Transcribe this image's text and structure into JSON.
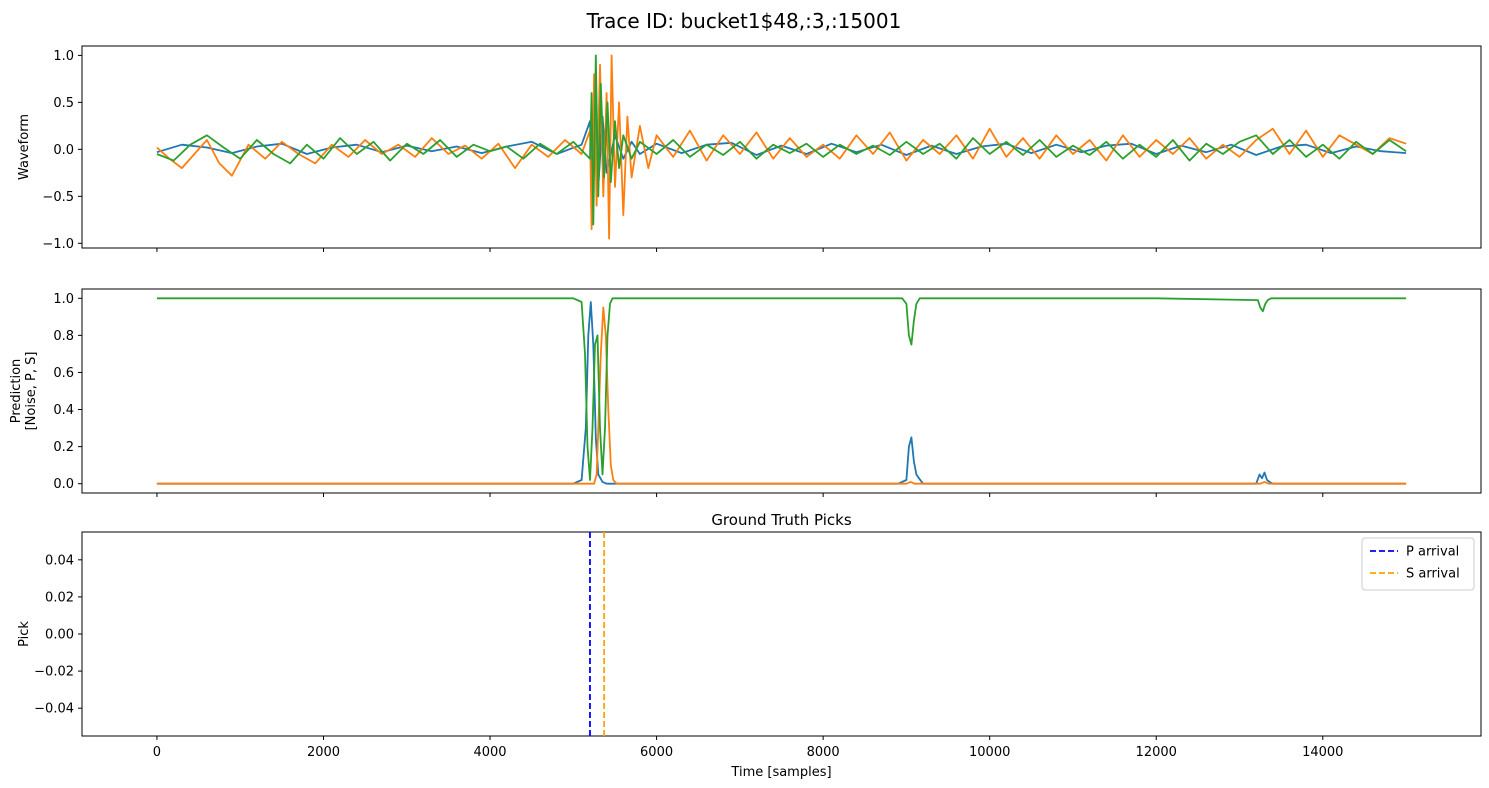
{
  "figure": {
    "title": "Trace ID: bucket1$48,:3,:15001"
  },
  "colors": {
    "blue": "#1f77b4",
    "orange": "#ff7f0e",
    "green": "#2ca02c",
    "p_line": "#0000ff",
    "s_line": "#ffa500"
  },
  "chart_data": [
    {
      "type": "line",
      "title": "",
      "xlabel": "",
      "ylabel": "Waveform",
      "xlim": [
        -900,
        15900
      ],
      "ylim": [
        -1.05,
        1.1
      ],
      "yticks": [
        1.0,
        0.5,
        0.0,
        -0.5,
        -1.0
      ],
      "ytick_labels": [
        "1.0",
        "0.5",
        "0.0",
        "−0.5",
        "−1.0"
      ],
      "xticks_shown": false,
      "grid": false,
      "series": [
        {
          "color": "blue",
          "x": [
            0,
            300,
            600,
            900,
            1200,
            1500,
            1800,
            2100,
            2400,
            2700,
            3000,
            3300,
            3600,
            3900,
            4200,
            4500,
            4800,
            5100,
            5200,
            5230,
            5260,
            5300,
            5350,
            5400,
            5500,
            5600,
            5700,
            5800,
            6000,
            6300,
            6600,
            6900,
            7200,
            7500,
            7800,
            8100,
            8400,
            8700,
            9000,
            9300,
            9600,
            9900,
            10200,
            10500,
            10800,
            11100,
            11400,
            11700,
            12000,
            12300,
            12600,
            12900,
            13200,
            13500,
            13800,
            14100,
            14400,
            14700,
            15000
          ],
          "y": [
            -0.03,
            0.05,
            0.02,
            -0.04,
            0.03,
            0.06,
            -0.05,
            0.02,
            0.05,
            -0.03,
            0.04,
            -0.02,
            0.03,
            -0.04,
            0.03,
            0.08,
            -0.05,
            0.05,
            0.3,
            -0.6,
            0.7,
            -0.4,
            0.35,
            -0.25,
            0.15,
            -0.1,
            0.08,
            -0.05,
            0.06,
            -0.04,
            0.05,
            0.07,
            -0.06,
            0.04,
            -0.05,
            0.06,
            -0.03,
            0.05,
            -0.06,
            0.04,
            -0.05,
            0.03,
            0.06,
            -0.04,
            0.05,
            -0.03,
            0.04,
            0.06,
            -0.05,
            0.04,
            -0.03,
            0.05,
            -0.06,
            0.03,
            0.05,
            -0.04,
            0.03,
            -0.02,
            -0.04
          ]
        },
        {
          "color": "orange",
          "x": [
            0,
            150,
            300,
            450,
            600,
            750,
            900,
            1100,
            1300,
            1500,
            1700,
            1900,
            2100,
            2300,
            2500,
            2700,
            2900,
            3100,
            3300,
            3500,
            3700,
            3900,
            4100,
            4300,
            4500,
            4700,
            4900,
            5100,
            5200,
            5220,
            5250,
            5280,
            5320,
            5360,
            5400,
            5430,
            5460,
            5500,
            5550,
            5600,
            5650,
            5700,
            5800,
            5900,
            6000,
            6200,
            6400,
            6600,
            6800,
            7000,
            7200,
            7400,
            7600,
            7800,
            8000,
            8200,
            8400,
            8600,
            8800,
            9000,
            9200,
            9400,
            9600,
            9800,
            10000,
            10200,
            10400,
            10600,
            10800,
            11000,
            11200,
            11400,
            11600,
            11800,
            12000,
            12200,
            12400,
            12600,
            12800,
            13000,
            13200,
            13400,
            13600,
            13800,
            14000,
            14200,
            14400,
            14600,
            14800,
            15000
          ],
          "y": [
            0.02,
            -0.1,
            -0.2,
            -0.05,
            0.1,
            -0.15,
            -0.28,
            0.05,
            -0.1,
            0.08,
            -0.05,
            -0.15,
            0.05,
            -0.08,
            0.1,
            -0.05,
            0.05,
            -0.08,
            0.12,
            -0.05,
            0.04,
            -0.1,
            0.06,
            -0.2,
            0.05,
            -0.08,
            0.1,
            -0.05,
            0.2,
            -0.85,
            0.8,
            -0.6,
            0.9,
            -0.5,
            0.6,
            -0.95,
            1.0,
            -0.4,
            0.5,
            -0.7,
            0.35,
            -0.3,
            0.25,
            -0.2,
            0.15,
            -0.08,
            0.2,
            -0.12,
            0.15,
            -0.05,
            0.18,
            -0.1,
            0.12,
            -0.08,
            0.05,
            -0.1,
            0.15,
            -0.05,
            0.18,
            -0.12,
            0.1,
            -0.05,
            0.15,
            -0.1,
            0.22,
            -0.08,
            0.12,
            -0.1,
            0.15,
            -0.05,
            0.1,
            -0.12,
            0.15,
            -0.08,
            0.1,
            -0.05,
            0.12,
            -0.1,
            0.05,
            -0.08,
            0.1,
            0.22,
            -0.05,
            0.2,
            -0.08,
            0.15,
            0.05,
            -0.05,
            0.12,
            0.06
          ]
        },
        {
          "color": "green",
          "x": [
            0,
            200,
            400,
            600,
            800,
            1000,
            1200,
            1400,
            1600,
            1800,
            2000,
            2200,
            2400,
            2600,
            2800,
            3000,
            3200,
            3400,
            3600,
            3800,
            4000,
            4200,
            4400,
            4600,
            4800,
            5000,
            5200,
            5220,
            5240,
            5270,
            5300,
            5330,
            5370,
            5410,
            5450,
            5500,
            5550,
            5600,
            5700,
            5800,
            6000,
            6200,
            6400,
            6600,
            6800,
            7000,
            7200,
            7400,
            7600,
            7800,
            8000,
            8200,
            8400,
            8600,
            8800,
            9000,
            9200,
            9400,
            9600,
            9800,
            10000,
            10200,
            10400,
            10600,
            10800,
            11000,
            11200,
            11400,
            11600,
            11800,
            12000,
            12200,
            12400,
            12600,
            12800,
            13000,
            13200,
            13400,
            13600,
            13800,
            14000,
            14200,
            14400,
            14600,
            14800,
            15000
          ],
          "y": [
            -0.05,
            -0.12,
            0.05,
            0.15,
            0.02,
            -0.1,
            0.1,
            -0.05,
            -0.15,
            0.05,
            -0.1,
            0.12,
            -0.05,
            0.08,
            -0.12,
            0.06,
            -0.05,
            0.1,
            -0.08,
            0.05,
            -0.02,
            0.03,
            -0.1,
            0.06,
            -0.05,
            0.08,
            -0.1,
            0.6,
            -0.8,
            1.0,
            -0.5,
            0.7,
            -0.3,
            0.5,
            -0.35,
            0.3,
            -0.2,
            0.15,
            -0.1,
            0.08,
            -0.05,
            0.1,
            -0.08,
            0.05,
            -0.06,
            0.08,
            -0.1,
            0.05,
            -0.04,
            0.06,
            -0.08,
            0.05,
            -0.05,
            0.04,
            -0.06,
            0.08,
            -0.05,
            0.06,
            -0.1,
            0.12,
            -0.05,
            0.08,
            -0.06,
            0.1,
            -0.08,
            0.04,
            -0.06,
            0.08,
            -0.1,
            0.05,
            -0.08,
            0.1,
            -0.12,
            0.06,
            -0.05,
            0.08,
            0.15,
            -0.05,
            0.1,
            -0.08,
            0.05,
            -0.1,
            0.08,
            -0.05,
            0.1,
            -0.02
          ]
        }
      ]
    },
    {
      "type": "line",
      "title": "",
      "xlabel": "",
      "ylabel": "Prediction\n[Noise, P, S]",
      "xlim": [
        -900,
        15900
      ],
      "ylim": [
        -0.05,
        1.05
      ],
      "yticks": [
        0.0,
        0.2,
        0.4,
        0.6,
        0.8,
        1.0
      ],
      "ytick_labels": [
        "0.0",
        "0.2",
        "0.4",
        "0.6",
        "0.8",
        "1.0"
      ],
      "xticks_shown": false,
      "grid": false,
      "series": [
        {
          "color": "blue",
          "x": [
            0,
            5000,
            5100,
            5150,
            5180,
            5210,
            5240,
            5270,
            5300,
            5350,
            5400,
            8900,
            9000,
            9030,
            9060,
            9090,
            9120,
            9150,
            9200,
            13200,
            13240,
            13270,
            13300,
            13330,
            13360,
            13400,
            15000
          ],
          "y": [
            0.0,
            0.0,
            0.02,
            0.3,
            0.8,
            0.98,
            0.75,
            0.25,
            0.05,
            0.01,
            0.0,
            0.0,
            0.02,
            0.2,
            0.25,
            0.12,
            0.05,
            0.03,
            0.0,
            0.0,
            0.05,
            0.03,
            0.06,
            0.02,
            0.01,
            0.0,
            0.0
          ]
        },
        {
          "color": "orange",
          "x": [
            0,
            5250,
            5280,
            5300,
            5330,
            5360,
            5390,
            5420,
            5450,
            5480,
            5520,
            6000,
            9000,
            9050,
            9100,
            9150,
            13250,
            13300,
            13350,
            15000
          ],
          "y": [
            0.0,
            0.0,
            0.05,
            0.3,
            0.7,
            0.95,
            0.8,
            0.4,
            0.1,
            0.02,
            0.0,
            0.0,
            0.0,
            0.01,
            0.0,
            0.0,
            0.0,
            0.01,
            0.0,
            0.0
          ]
        },
        {
          "color": "green",
          "x": [
            0,
            2000,
            4000,
            5000,
            5100,
            5140,
            5170,
            5200,
            5230,
            5260,
            5290,
            5320,
            5350,
            5380,
            5410,
            5440,
            5470,
            5500,
            6000,
            8000,
            8950,
            9000,
            9030,
            9060,
            9090,
            9120,
            9160,
            9220,
            12000,
            13220,
            13250,
            13280,
            13310,
            13340,
            13380,
            15000
          ],
          "y": [
            1.0,
            1.0,
            1.0,
            1.0,
            0.98,
            0.7,
            0.2,
            0.02,
            0.3,
            0.75,
            0.8,
            0.3,
            0.05,
            0.3,
            0.8,
            0.97,
            1.0,
            1.0,
            1.0,
            1.0,
            1.0,
            0.97,
            0.8,
            0.75,
            0.88,
            0.97,
            1.0,
            1.0,
            1.0,
            0.99,
            0.95,
            0.93,
            0.97,
            0.99,
            1.0,
            1.0
          ]
        }
      ]
    },
    {
      "type": "line",
      "title": "Ground Truth Picks",
      "xlabel": "Time [samples]",
      "ylabel": "Pick",
      "xlim": [
        -900,
        15900
      ],
      "ylim": [
        -0.055,
        0.055
      ],
      "yticks": [
        0.04,
        0.02,
        0.0,
        -0.02,
        -0.04
      ],
      "ytick_labels": [
        "0.04",
        "0.02",
        "0.00",
        "−0.02",
        "−0.04"
      ],
      "xticks": [
        0,
        2000,
        4000,
        6000,
        8000,
        10000,
        12000,
        14000
      ],
      "xtick_labels": [
        "0",
        "2000",
        "4000",
        "6000",
        "8000",
        "10000",
        "12000",
        "14000"
      ],
      "grid": false,
      "legend": {
        "position": "top-right",
        "entries": [
          {
            "label": "P arrival",
            "color": "p_line",
            "style": "dashed"
          },
          {
            "label": "S arrival",
            "color": "s_line",
            "style": "dashed"
          }
        ]
      },
      "vlines": [
        {
          "label": "P arrival",
          "x": 5200,
          "color": "p_line",
          "style": "dashed"
        },
        {
          "label": "S arrival",
          "x": 5370,
          "color": "s_line",
          "style": "dashed"
        }
      ],
      "series": []
    }
  ]
}
